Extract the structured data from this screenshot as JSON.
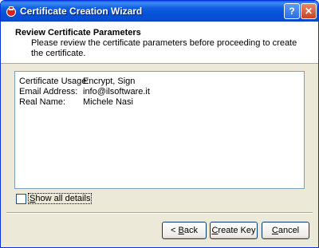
{
  "window": {
    "title": "Certificate Creation Wizard",
    "help_label": "?",
    "close_label": "✕",
    "icon": "certificate-app-icon"
  },
  "header": {
    "title": "Review Certificate Parameters",
    "description": "Please review the certificate parameters before proceeding to create the certificate."
  },
  "details": [
    {
      "label": "Certificate Usage:",
      "value": "Encrypt, Sign"
    },
    {
      "label": "Email Address:",
      "value": "info@ilsoftware.it"
    },
    {
      "label": "Real Name:",
      "value": "Michele Nasi"
    }
  ],
  "show_all": {
    "label_first": "S",
    "label_rest": "how all details",
    "checked": false
  },
  "buttons": {
    "back_prefix": "< ",
    "back_key": "B",
    "back_rest": "ack",
    "create_key": "C",
    "create_rest": "reate Key",
    "cancel_key": "C",
    "cancel_rest": "ancel"
  }
}
